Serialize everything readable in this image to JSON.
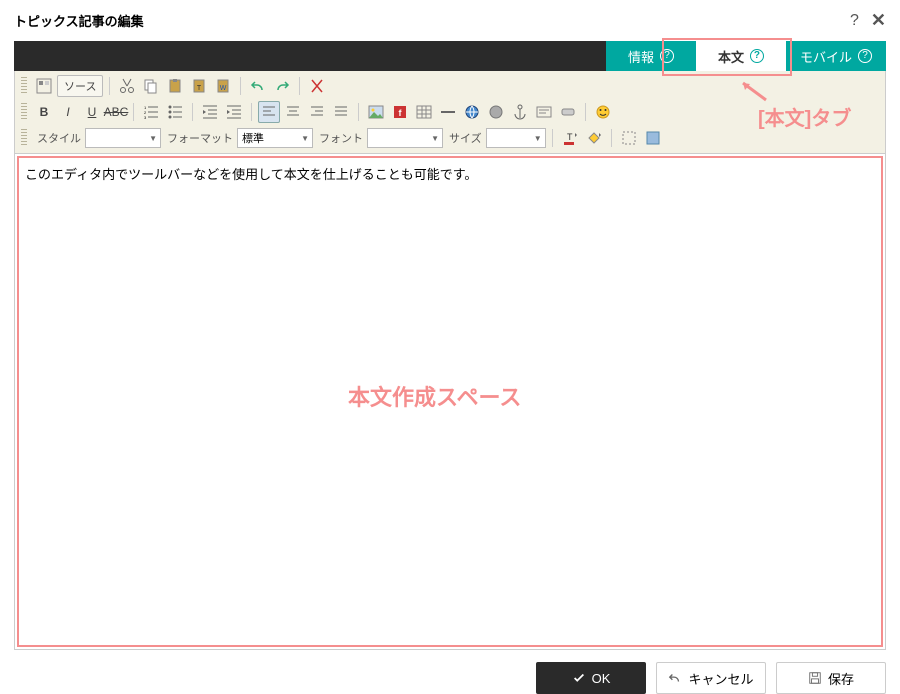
{
  "header": {
    "title": "トピックス記事の編集"
  },
  "tabs": {
    "info": "情報",
    "body": "本文",
    "mobile": "モバイル"
  },
  "annotations": {
    "tab_label": "[本文]タブ",
    "editor_label": "本文作成スペース"
  },
  "toolbar": {
    "source": "ソース",
    "style_label": "スタイル",
    "format_label": "フォーマット",
    "format_value": "標準",
    "font_label": "フォント",
    "size_label": "サイズ"
  },
  "editor": {
    "content": "このエディタ内でツールバーなどを使用して本文を仕上げることも可能です。"
  },
  "footer": {
    "ok": "OK",
    "cancel": "キャンセル",
    "save": "保存"
  }
}
